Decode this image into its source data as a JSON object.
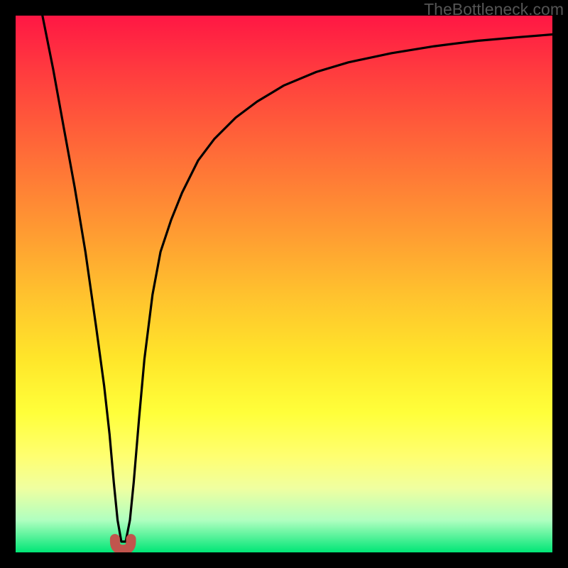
{
  "watermark": "TheBottleneck.com",
  "chart_data": {
    "type": "line",
    "title": "",
    "xlabel": "",
    "ylabel": "",
    "xlim": [
      0,
      100
    ],
    "ylim": [
      0,
      100
    ],
    "grid": false,
    "legend": false,
    "gradient": {
      "top_color": "#ff1744",
      "mid_colors": [
        "#ff7a36",
        "#ffe62a",
        "#ffff70"
      ],
      "bottom_color": "#00e676"
    },
    "series": [
      {
        "name": "bottleneck-curve",
        "stroke": "#000000",
        "x": [
          5,
          7,
          9,
          11,
          13,
          15,
          16.5,
          17.5,
          18.3,
          19.0,
          19.7,
          20.5,
          21.3,
          22.0,
          23.0,
          24.0,
          25.5,
          27.0,
          29.0,
          31.0,
          34.0,
          37.0,
          41.0,
          45.0,
          50.0,
          56.0,
          62.0,
          70.0,
          78.0,
          86.0,
          94.0,
          100.0
        ],
        "y": [
          100,
          90,
          79,
          68,
          56,
          42,
          31,
          22,
          13,
          6,
          2,
          2,
          6,
          13,
          25,
          36,
          48,
          56,
          62,
          67,
          73,
          77,
          81,
          84,
          87,
          89.5,
          91.3,
          93,
          94.3,
          95.3,
          96,
          96.5
        ]
      },
      {
        "name": "optimal-marker",
        "stroke": "#c1554d",
        "shape": "u",
        "x": [
          18.5,
          21.5
        ],
        "y": [
          2.5,
          2.5
        ],
        "bottom_y": 0.5
      }
    ]
  }
}
